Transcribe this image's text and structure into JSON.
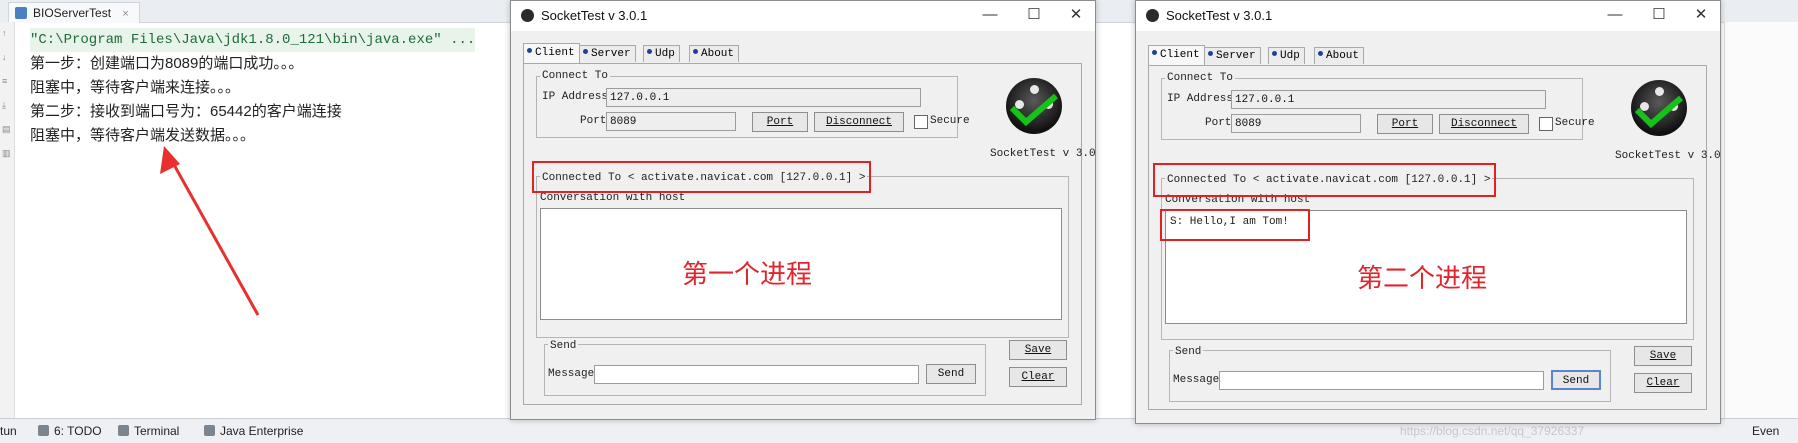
{
  "ide": {
    "tab_label": "BIOServerTest",
    "console_lines": [
      "\"C:\\Program Files\\Java\\jdk1.8.0_121\\bin\\java.exe\" ...",
      "第一步：创建端口为8089的端口成功。。。",
      "阻塞中，等待客户端来连接。。。",
      "第二步：接收到端口号为：65442的客户端连接",
      "阻塞中，等待客户端发送数据。。。"
    ],
    "status_items": [
      "tun",
      "6: TODO",
      "Terminal",
      "Java Enterprise"
    ],
    "status_right": "Even",
    "watermark": "https://blog.csdn.net/qq_37926337"
  },
  "windows": [
    {
      "title": "SocketTest v 3.0.1",
      "tabs": [
        "Client",
        "Server",
        "Udp",
        "About"
      ],
      "active_tab": "Client",
      "connect_to_label": "Connect To",
      "ip_label": "IP Address",
      "ip_value": "127.0.0.1",
      "port_label": "Port",
      "port_value": "8089",
      "port_button": "Port",
      "disconnect_button": "Disconnect",
      "secure_label": "Secure",
      "logo_caption": "SocketTest v 3.0",
      "connected_to": "Connected To <  activate.navicat.com [127.0.0.1]  >",
      "conversation_label": "Conversation with host",
      "conversation_text": "",
      "annotation": "第一个进程",
      "save_button": "Save",
      "send_label": "Send",
      "message_label": "Message",
      "message_value": "",
      "send_button": "Send",
      "clear_button": "Clear"
    },
    {
      "title": "SocketTest v 3.0.1",
      "tabs": [
        "Client",
        "Server",
        "Udp",
        "About"
      ],
      "active_tab": "Client",
      "connect_to_label": "Connect To",
      "ip_label": "IP Address",
      "ip_value": "127.0.0.1",
      "port_label": "Port",
      "port_value": "8089",
      "port_button": "Port",
      "disconnect_button": "Disconnect",
      "secure_label": "Secure",
      "logo_caption": "SocketTest v 3.0",
      "connected_to": "Connected To <  activate.navicat.com [127.0.0.1]  >",
      "conversation_label": "Conversation with host",
      "conversation_text": "S: Hello,I am Tom!",
      "annotation": "第二个进程",
      "save_button": "Save",
      "send_label": "Send",
      "message_label": "Message",
      "message_value": "",
      "send_button": "Send",
      "clear_button": "Clear"
    }
  ],
  "colors": {
    "annotation_red": "#e02222",
    "logo_check_green": "#16c21a",
    "tab_dot_blue": "#1f3f9a"
  }
}
